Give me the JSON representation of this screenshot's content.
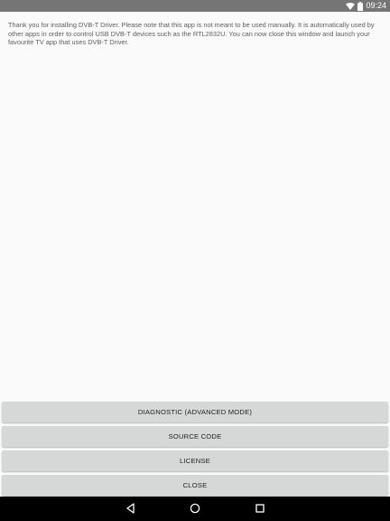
{
  "status_bar": {
    "time": "09:24",
    "icons": [
      "wifi-icon",
      "battery-icon"
    ]
  },
  "message": {
    "text": "Thank you for installing DVB-T Driver. Please note that this app is not meant to be used manually. It is automatically used by other apps in order to control USB DVB-T devices such as the RTL2832U. You can now close this window and launch your favourite TV app that uses DVB-T Driver."
  },
  "buttons": {
    "diagnostic": "DIAGNOSTIC (ADVANCED MODE)",
    "source_code": "SOURCE CODE",
    "license": "LICENSE",
    "close": "CLOSE"
  },
  "nav_bar": {
    "icons": [
      "back-icon",
      "home-icon",
      "recents-icon"
    ]
  },
  "colors": {
    "status_bar": "#757575",
    "background": "#fafafa",
    "button": "#d6d7d7",
    "nav_bar": "#000000"
  }
}
